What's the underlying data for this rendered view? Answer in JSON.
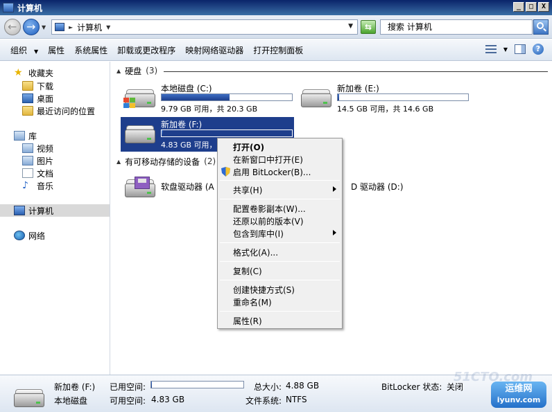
{
  "window": {
    "title": "计算机",
    "controls": [
      "_",
      "□",
      "X"
    ]
  },
  "addressbar": {
    "crumb": "计算机",
    "search_placeholder": "搜索 计算机"
  },
  "toolbar": {
    "items": [
      "组织",
      "属性",
      "系统属性",
      "卸载或更改程序",
      "映射网络驱动器",
      "打开控制面板"
    ]
  },
  "navpane": {
    "favorites": "收藏夹",
    "favorites_items": [
      "下载",
      "桌面",
      "最近访问的位置"
    ],
    "libraries": "库",
    "library_items": [
      "视频",
      "图片",
      "文档",
      "音乐"
    ],
    "computer": "计算机",
    "network": "网络"
  },
  "content": {
    "group_hdd": {
      "label": "硬盘",
      "count": "(3)"
    },
    "group_removable": {
      "label": "有可移动存储的设备",
      "count": "(2)"
    },
    "drives": [
      {
        "name": "本地磁盘 (C:)",
        "info": "9.79 GB 可用，共 20.3 GB",
        "used_fraction": 0.52
      },
      {
        "name": "新加卷 (E:)",
        "info": "14.5 GB 可用，共 14.6 GB",
        "used_fraction": 0.01
      },
      {
        "name": "新加卷 (F:)",
        "info": "4.83 GB 可用，",
        "used_fraction": 0.01
      }
    ],
    "removable": [
      {
        "name": "软盘驱动器 (A"
      },
      {
        "name": "D 驱动器 (D:)"
      }
    ]
  },
  "context_menu": {
    "items": [
      "打开(O)",
      "在新窗口中打开(E)",
      "启用 BitLocker(B)...",
      "共享(H)",
      "配置卷影副本(W)...",
      "还原以前的版本(V)",
      "包含到库中(I)",
      "格式化(A)...",
      "复制(C)",
      "创建快捷方式(S)",
      "重命名(M)",
      "属性(R)"
    ]
  },
  "details": {
    "drive_name": "新加卷 (F:)",
    "drive_type": "本地磁盘",
    "used_label": "已用空间:",
    "free_label": "可用空间:",
    "free_value": "4.83 GB",
    "total_label": "总大小:",
    "total_value": "4.88 GB",
    "fs_label": "文件系统:",
    "fs_value": "NTFS",
    "bitlocker_label": "BitLocker 状态:",
    "bitlocker_value": "关闭",
    "used_fraction": 0.01
  },
  "watermark": {
    "faint": "51CTO.com",
    "logo_line1": "运维网",
    "logo_line2": "iyunv.com"
  }
}
